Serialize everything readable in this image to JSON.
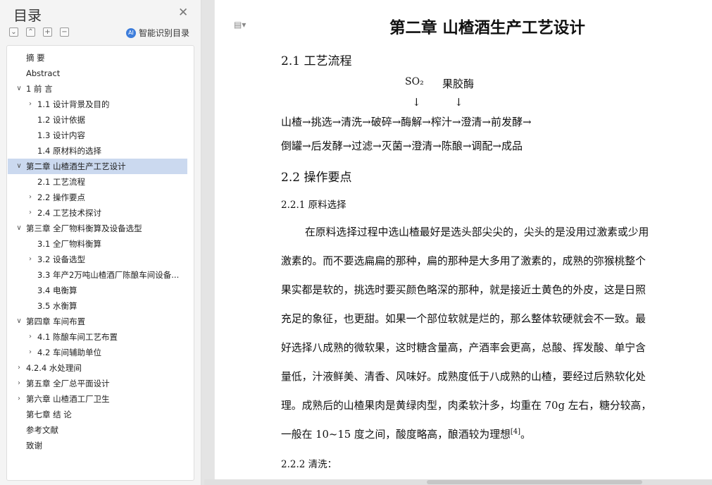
{
  "sidebar": {
    "title": "目录",
    "smart_label": "智能识别目录",
    "toc": [
      {
        "label": "摘  要"
      },
      {
        "label": "Abstract"
      },
      {
        "label": "1 前  言",
        "arrow": "∨"
      },
      {
        "label": "1.1 设计背景及目的",
        "arrow": "›"
      },
      {
        "label": "1.2 设计依据"
      },
      {
        "label": "1.3 设计内容"
      },
      {
        "label": "1.4 原材料的选择"
      },
      {
        "label": "第二章  山楂酒生产工艺设计",
        "arrow": "∨",
        "active": true
      },
      {
        "label": "2.1 工艺流程"
      },
      {
        "label": "2.2 操作要点",
        "arrow": "›"
      },
      {
        "label": "2.4 工艺技术探讨",
        "arrow": "›"
      },
      {
        "label": "第三章  全厂物料衡算及设备选型",
        "arrow": "∨"
      },
      {
        "label": "3.1 全厂物料衡算"
      },
      {
        "label": "3.2 设备选型",
        "arrow": "›"
      },
      {
        "label": "3.3 年产2万吨山楂酒厂陈酿车间设备..."
      },
      {
        "label": "3.4 电衡算"
      },
      {
        "label": "3.5 水衡算"
      },
      {
        "label": "第四章  车间布置",
        "arrow": "∨"
      },
      {
        "label": "4.1 陈酿车间工艺布置",
        "arrow": "›"
      },
      {
        "label": "4.2  车间辅助单位",
        "arrow": "›"
      },
      {
        "label": "4.2.4 水处理间",
        "arrow": "›"
      },
      {
        "label": "第五章  全厂总平面设计",
        "arrow": "›"
      },
      {
        "label": "第六章  山楂酒工厂卫生",
        "arrow": "›"
      },
      {
        "label": "第七章  结  论"
      },
      {
        "label": "参考文献"
      },
      {
        "label": "致谢"
      }
    ]
  },
  "doc": {
    "chapter_title": "第二章 山楂酒生产工艺设计",
    "sec_2_1": "2.1 工艺流程",
    "flow_so2": "SO₂",
    "flow_pectinase": "果胶酶",
    "flow_arrow": "↓",
    "flow_line1": "山楂→挑选→清洗→破碎→酶解→榨汁→澄清→前发酵→",
    "flow_line2": "倒罐→后发酵→过滤→灭菌→澄清→陈酿→调配→成品",
    "sec_2_2": "2.2 操作要点",
    "sub_2_2_1": "2.2.1 原料选择",
    "paragraph": [
      "在原料选择过程中选山楂最好是选头部尖尖的，尖头的是没用过激素或少用",
      "激素的。而不要选扁扁的那种，扁的那种是大多用了激素的，成熟的弥猴桃整个",
      "果实都是软的，挑选时要买颜色略深的那种，就是接近土黄色的外皮，这是日照",
      "充足的象征，也更甜。如果一个部位软就是烂的，那么整体软硬就会不一致。最",
      "好选择八成熟的微软果，这时糖含量高，产酒率会更高，总酸、挥发酸、单宁含",
      "量低，汁液鲜美、清香、风味好。成熟度低于八成熟的山楂，要经过后熟软化处",
      "理。成熟后的山楂果肉是黄绿肉型，肉柔软汁多，均重在 70g 左右，糖分较高，",
      "一般在 10~15 度之间，酸度略高，酿酒较为理想"
    ],
    "citation": "[4]",
    "para_end": "。",
    "sub_2_2_2": "2.2.2 清洗："
  }
}
